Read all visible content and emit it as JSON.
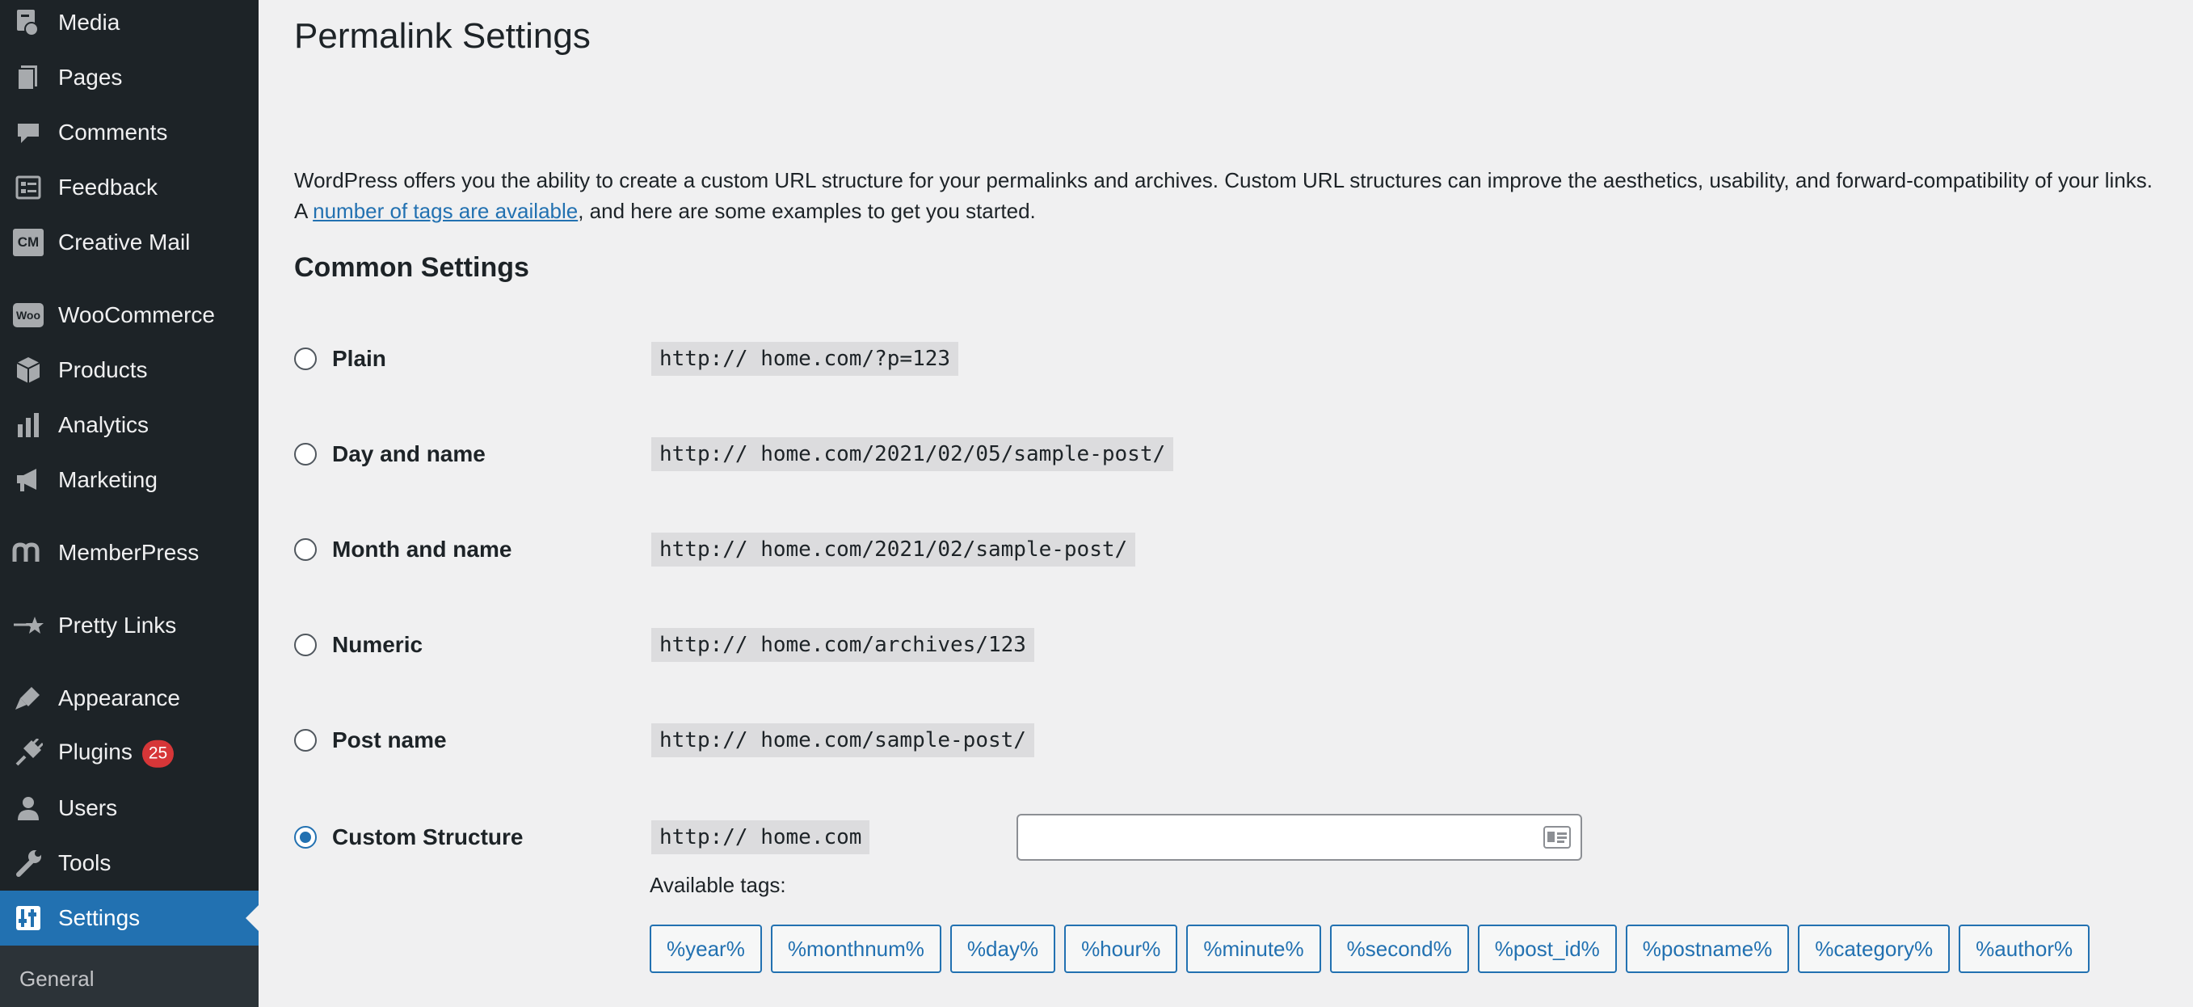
{
  "sidebar": {
    "items": [
      {
        "label": "Media",
        "icon": "media-icon"
      },
      {
        "label": "Pages",
        "icon": "pages-icon"
      },
      {
        "label": "Comments",
        "icon": "comments-icon"
      },
      {
        "label": "Feedback",
        "icon": "feedback-icon"
      },
      {
        "label": "Creative Mail",
        "icon": "creative-mail-icon"
      },
      {
        "label": "WooCommerce",
        "icon": "woocommerce-icon"
      },
      {
        "label": "Products",
        "icon": "products-icon"
      },
      {
        "label": "Analytics",
        "icon": "analytics-icon"
      },
      {
        "label": "Marketing",
        "icon": "marketing-icon"
      },
      {
        "label": "MemberPress",
        "icon": "memberpress-icon"
      },
      {
        "label": "Pretty Links",
        "icon": "pretty-links-icon"
      },
      {
        "label": "Appearance",
        "icon": "appearance-icon"
      },
      {
        "label": "Plugins",
        "icon": "plugins-icon",
        "badge": "25"
      },
      {
        "label": "Users",
        "icon": "users-icon"
      },
      {
        "label": "Tools",
        "icon": "tools-icon"
      },
      {
        "label": "Settings",
        "icon": "settings-icon",
        "active": true
      }
    ],
    "submenu": {
      "label": "General"
    },
    "creative_mail_abbr": "CM",
    "woo_abbr": "Woo"
  },
  "page": {
    "title": "Permalink Settings",
    "intro_before": "WordPress offers you the ability to create a custom URL structure for your permalinks and archives. Custom URL structures can improve the aesthetics, usability, and forward-compatibility of your links. A ",
    "intro_link": "number of tags are available",
    "intro_after": ", and here are some examples to get you started.",
    "section_title": "Common Settings"
  },
  "options": [
    {
      "label": "Plain",
      "example": "http:// home.com/?p=123",
      "checked": false
    },
    {
      "label": "Day and name",
      "example": "http:// home.com/2021/02/05/sample-post/",
      "checked": false
    },
    {
      "label": "Month and name",
      "example": "http:// home.com/2021/02/sample-post/",
      "checked": false
    },
    {
      "label": "Numeric",
      "example": "http:// home.com/archives/123",
      "checked": false
    },
    {
      "label": "Post name",
      "example": "http:// home.com/sample-post/",
      "checked": false
    },
    {
      "label": "Custom Structure",
      "example": "http:// home.com",
      "checked": true,
      "value": ""
    }
  ],
  "available_tags_label": "Available tags:",
  "tags": [
    "%year%",
    "%monthnum%",
    "%day%",
    "%hour%",
    "%minute%",
    "%second%",
    "%post_id%",
    "%postname%",
    "%category%",
    "%author%"
  ],
  "colors": {
    "sidebar_bg": "#1d2327",
    "accent": "#2271b1",
    "badge": "#d63638",
    "page_bg": "#f0f0f1"
  }
}
